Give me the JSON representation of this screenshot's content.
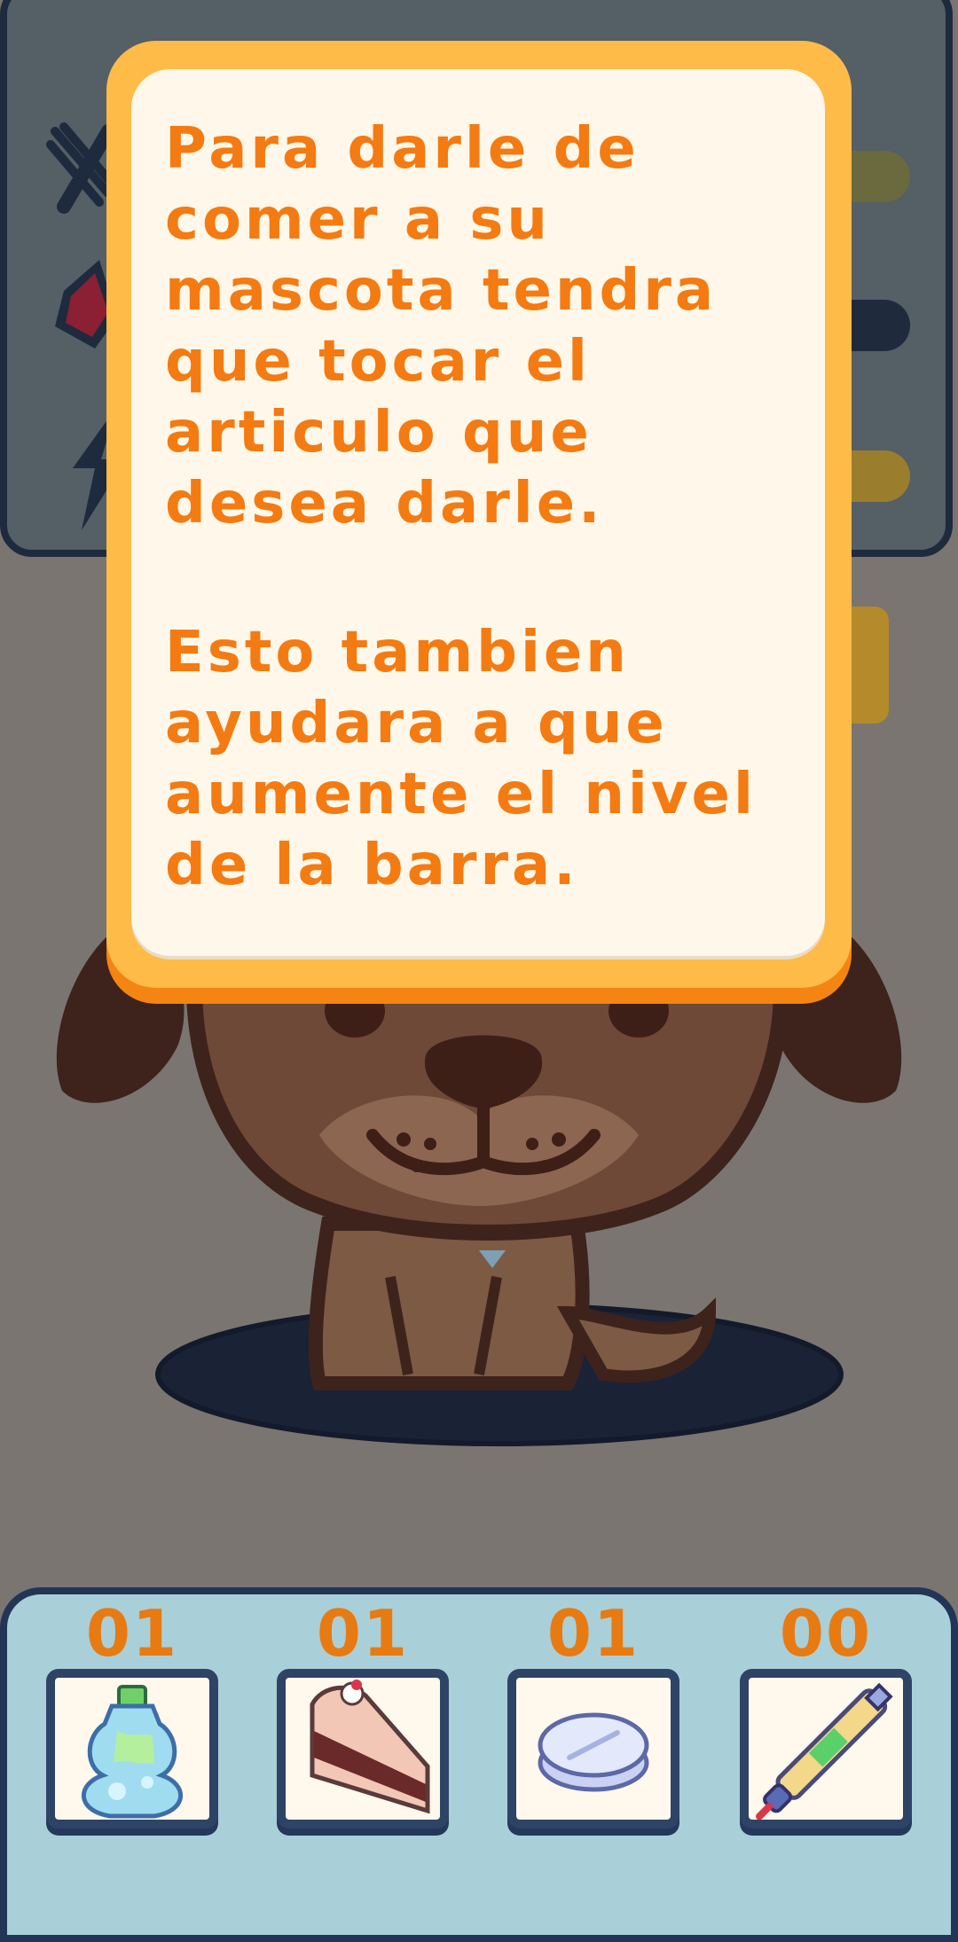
{
  "tutorial": {
    "paragraph1": "Para darle de comer a su mascota tendra que tocar el articulo que desea darle.",
    "paragraph2": "Esto tambien ayudara a que aumente el nivel de la barra."
  },
  "stats": {
    "hunger_icon": "fork-knife-icon",
    "hygiene_icon": "soap-icon",
    "energy_icon": "lightning-icon",
    "bar_colors": [
      "#6b6a3e",
      "#1f2b3d",
      "#9a7e2e"
    ]
  },
  "pet": {
    "name_icon": "brown-puppy"
  },
  "inventory": {
    "items": [
      {
        "count": "01",
        "icon": "water-bottle-icon"
      },
      {
        "count": "01",
        "icon": "cake-slice-icon"
      },
      {
        "count": "01",
        "icon": "pill-tablet-icon"
      },
      {
        "count": "00",
        "icon": "syringe-pen-icon"
      }
    ]
  },
  "colors": {
    "dialog_text": "#f47a12",
    "dialog_border": "#ffbb48",
    "count_text": "#e87a12",
    "inventory_bg": "#a9d0d9"
  }
}
